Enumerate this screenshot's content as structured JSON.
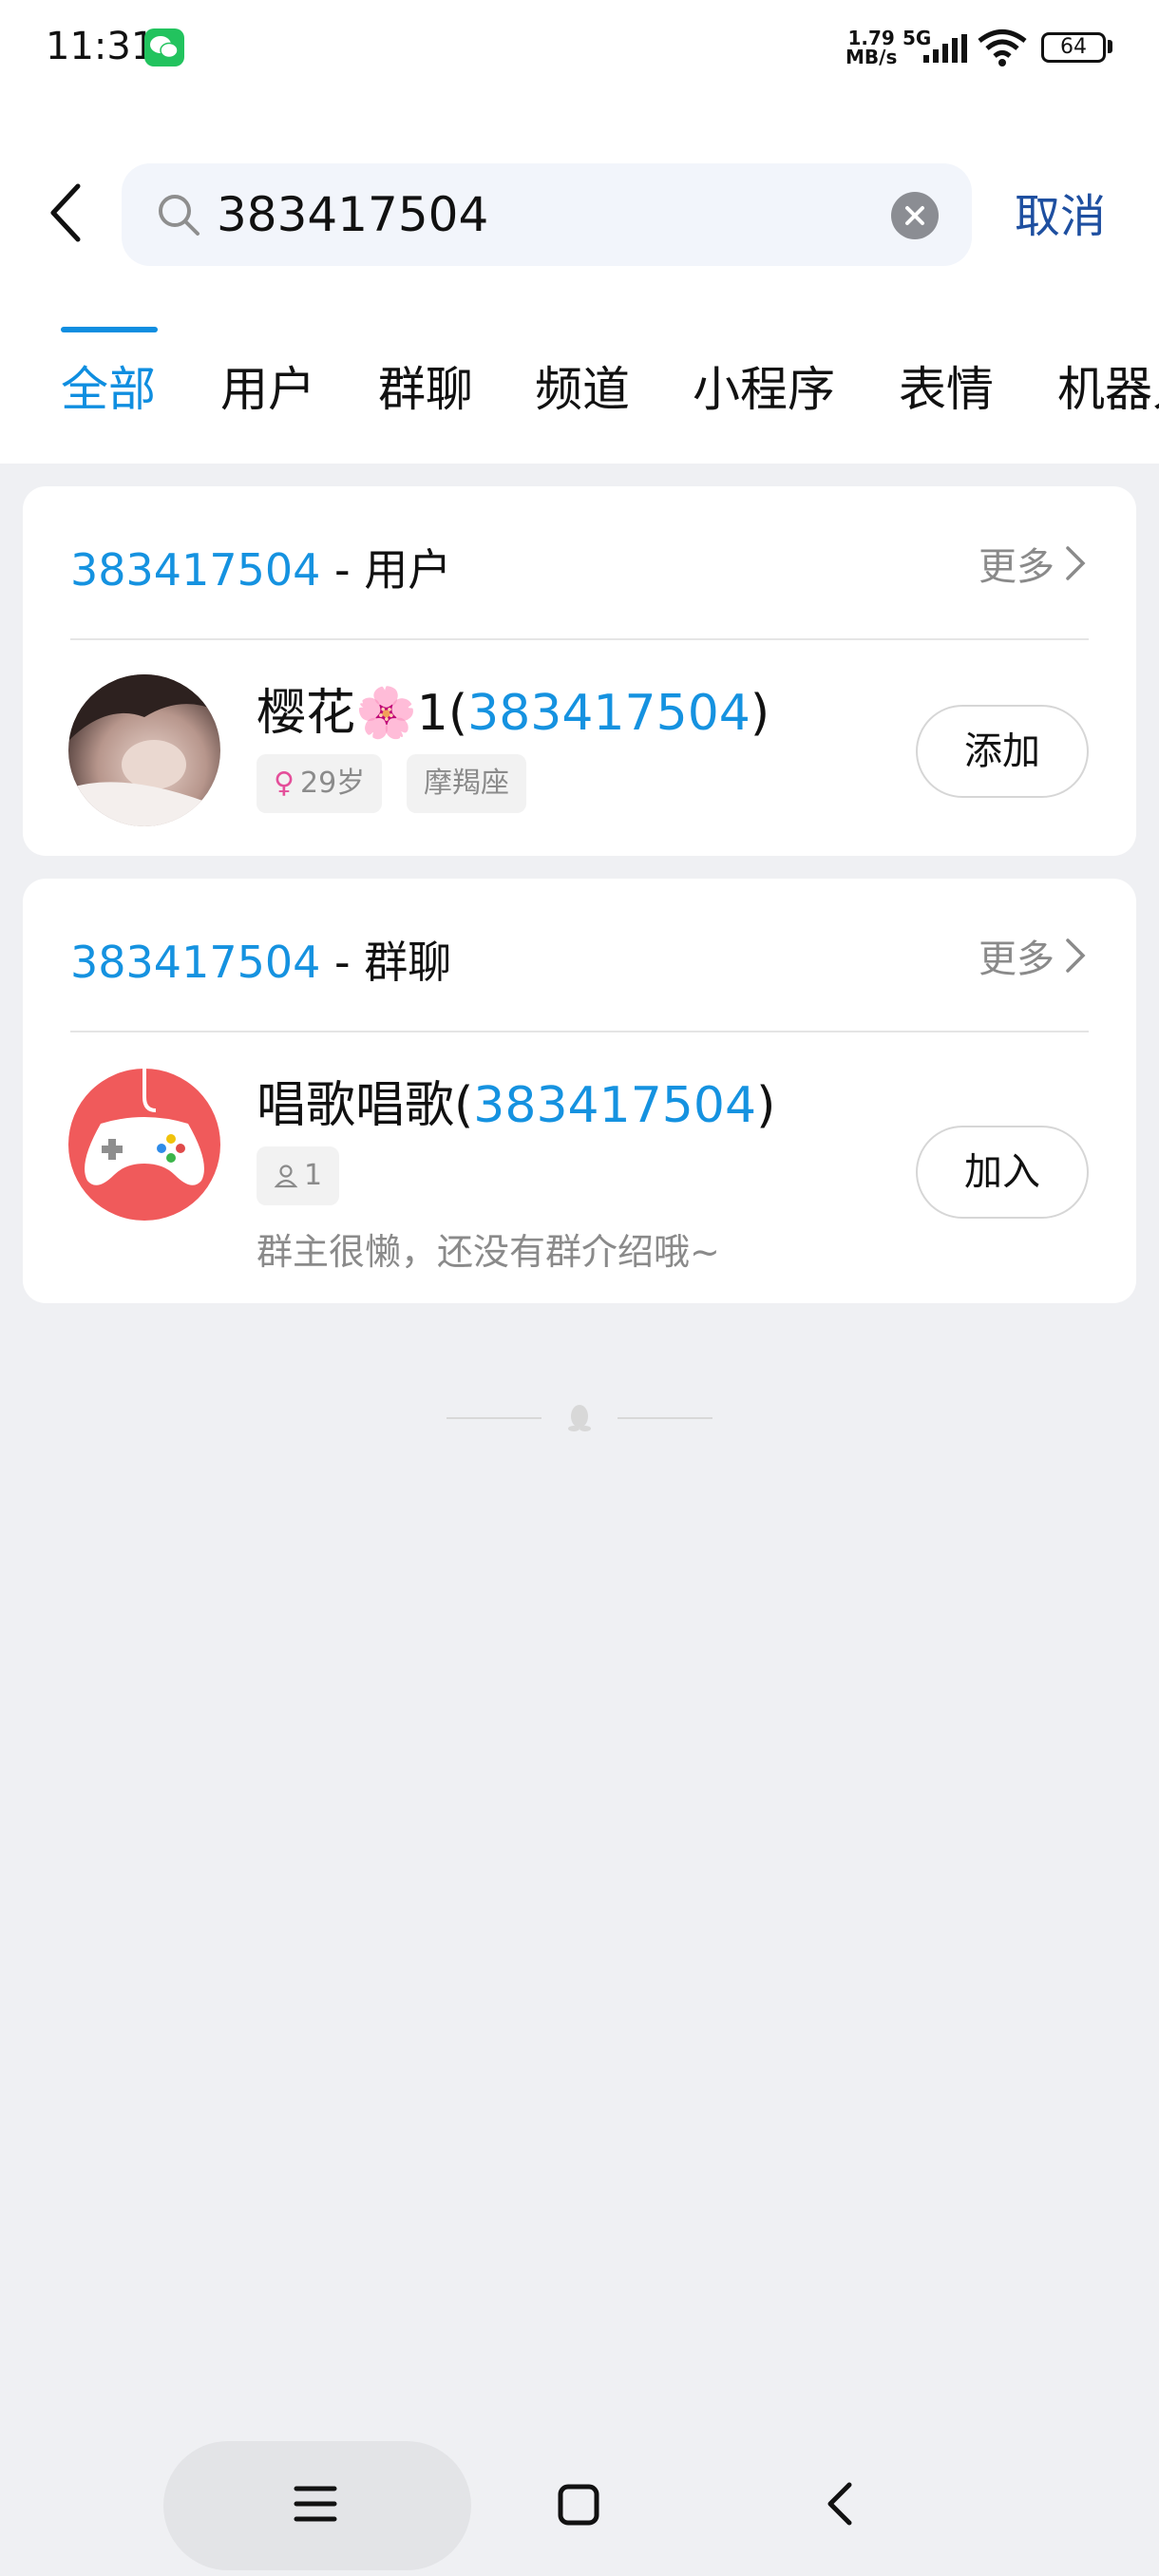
{
  "status_bar": {
    "time": "11:31",
    "net_speed_value": "1.79",
    "net_speed_unit": "MB/s",
    "network": "5G",
    "battery": "64"
  },
  "search": {
    "query": "383417504",
    "cancel_label": "取消"
  },
  "tabs": [
    "全部",
    "用户",
    "群聊",
    "频道",
    "小程序",
    "表情",
    "机器人"
  ],
  "sections": {
    "users": {
      "query": "383417504",
      "type_label": " - 用户",
      "more_label": "更多",
      "item": {
        "name_prefix": "樱花🌸1(",
        "name_id": "383417504",
        "name_suffix": ")",
        "gender_symbol": "♀",
        "age": "29岁",
        "constellation": "摩羯座",
        "action_label": "添加"
      }
    },
    "groups": {
      "query": "383417504",
      "type_label": " - 群聊",
      "more_label": "更多",
      "item": {
        "name_prefix": "唱歌唱歌(",
        "name_id": "383417504",
        "name_suffix": ")",
        "member_count": "1",
        "description": "群主很懒，还没有群介绍哦~",
        "action_label": "加入"
      }
    }
  },
  "colors": {
    "accent": "#1592e0",
    "cancel": "#1e4fa0",
    "group_avatar": "#f05a5b"
  }
}
